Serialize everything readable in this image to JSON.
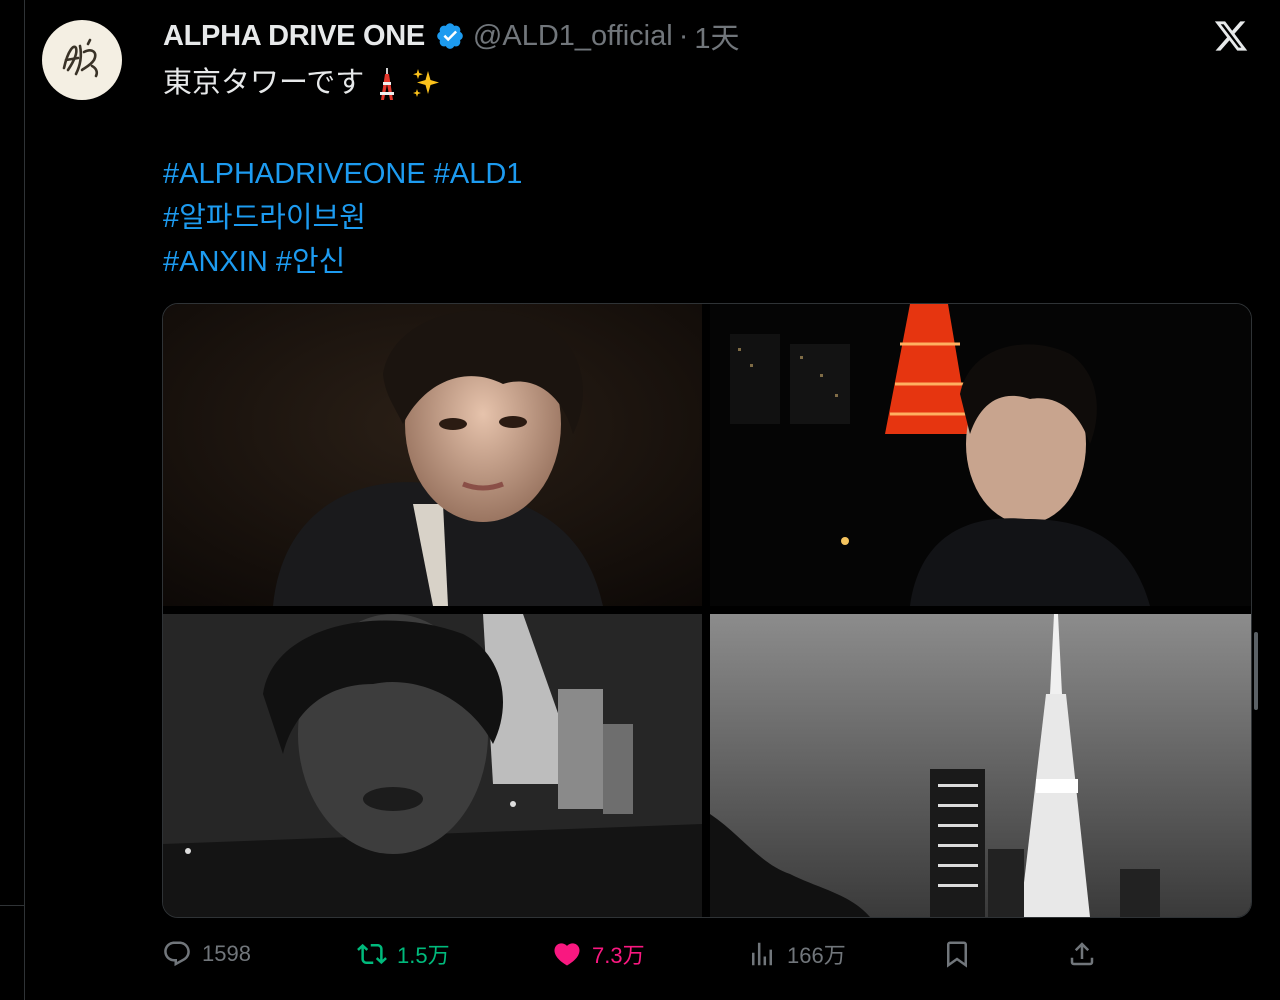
{
  "tweet": {
    "display_name": "ALPHA DRIVE ONE",
    "handle": "@ALD1_official",
    "separator": "·",
    "time": "1天",
    "text_line": "東京タワーです",
    "hashtags": [
      [
        "#ALPHADRIVEONE",
        "#ALD1"
      ],
      [
        "#알파드라이브원"
      ],
      [
        "#ANXIN",
        "#안신"
      ]
    ]
  },
  "avatar": {
    "logo_text": "ALD1"
  },
  "media": {
    "photo_count": 4
  },
  "actions": {
    "replies": "1598",
    "retweets": "1.5万",
    "likes": "7.3万",
    "views": "166万"
  },
  "icons": {
    "verified": "verified-badge-icon",
    "x_logo": "x-logo-icon",
    "reply": "reply-icon",
    "retweet": "retweet-icon",
    "like": "heart-icon",
    "views": "views-icon",
    "bookmark": "bookmark-icon",
    "share": "share-icon"
  },
  "colors": {
    "accent": "#1d9bf0",
    "retweet": "#00ba7c",
    "like": "#f91880",
    "muted": "#71767b",
    "background": "#000000"
  }
}
